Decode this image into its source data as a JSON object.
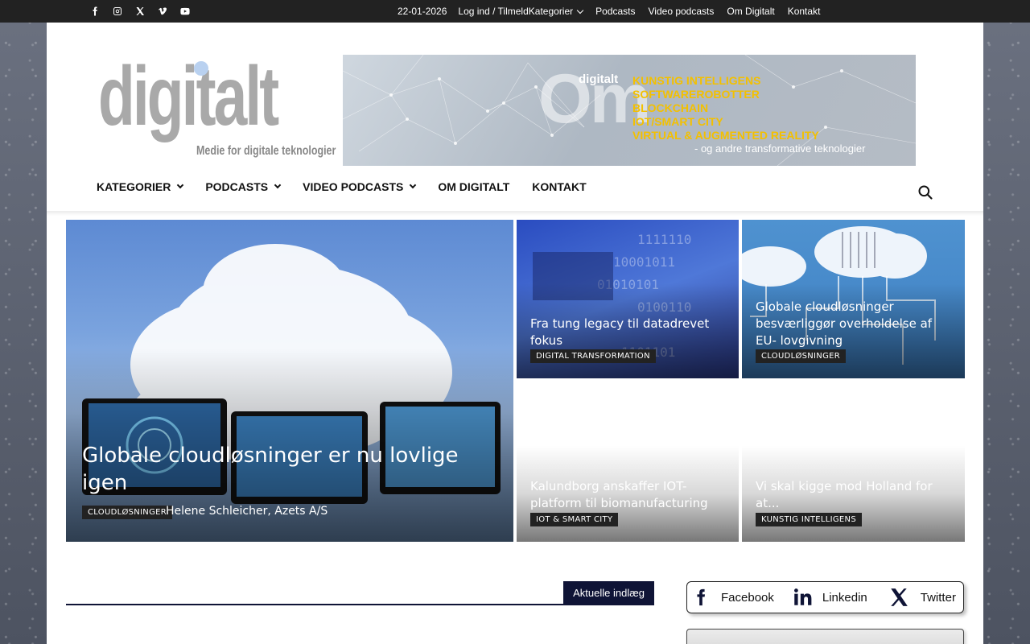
{
  "topbar": {
    "socials": [
      "facebook-icon",
      "instagram-icon",
      "x-icon",
      "vimeo-icon",
      "youtube-icon"
    ],
    "date": "22-01-2026",
    "login": "Log ind / Tilmeld",
    "links": [
      "Kategorier",
      "Podcasts",
      "Video podcasts",
      "Om Digitalt",
      "Kontakt"
    ]
  },
  "logo": {
    "word": "digitalt",
    "tagline": "Medie for digitale teknologier"
  },
  "banner": {
    "big": "Om",
    "brand": "digitalt",
    "items": [
      "KUNSTIG INTELLIGENS",
      "SOFTWAREROBOTTER",
      "BLOCKCHAIN",
      "IOT/SMART CITY",
      "VIRTUAL & AUGMENTED REALITY"
    ],
    "subline": "- og andre transformative teknologier"
  },
  "nav": {
    "items": [
      {
        "label": "KATEGORIER",
        "dropdown": true
      },
      {
        "label": "PODCASTS",
        "dropdown": true
      },
      {
        "label": "VIDEO PODCASTS",
        "dropdown": true
      },
      {
        "label": "OM DIGITALT",
        "dropdown": false
      },
      {
        "label": "KONTAKT",
        "dropdown": false
      }
    ]
  },
  "hero": {
    "main": {
      "title": "Globale cloudløsninger er nu lovlige igen",
      "category": "CLOUDLØSNINGER",
      "author": "Helene Schleicher, Azets A/S"
    },
    "tiles": [
      {
        "title": "Fra tung legacy til datadrevet fokus",
        "category": "DIGITAL TRANSFORMATION"
      },
      {
        "title": "Globale cloudløsninger besværliggør overholdelse af EU- lovgivning",
        "category": "CLOUDLØSNINGER"
      },
      {
        "title": "Kalundborg anskaffer IOT-platform til biomanufacturing",
        "category": "IOT & SMART CITY"
      },
      {
        "title": "Vi skal kigge mod Holland for at...",
        "category": "KUNSTIG INTELLIGENS"
      }
    ]
  },
  "section": {
    "label": "Aktuelle indlæg"
  },
  "share": {
    "items": [
      {
        "label": "Facebook",
        "icon": "facebook-icon"
      },
      {
        "label": "Linkedin",
        "icon": "linkedin-icon"
      },
      {
        "label": "Twitter",
        "icon": "x-icon"
      }
    ]
  },
  "colors": {
    "topbar": "#222222",
    "dark_navy": "#0f1436",
    "banner_yellow": "#f3c000",
    "logo_gray": "#a9a9a9",
    "logo_dot": "#b9d1f0"
  }
}
